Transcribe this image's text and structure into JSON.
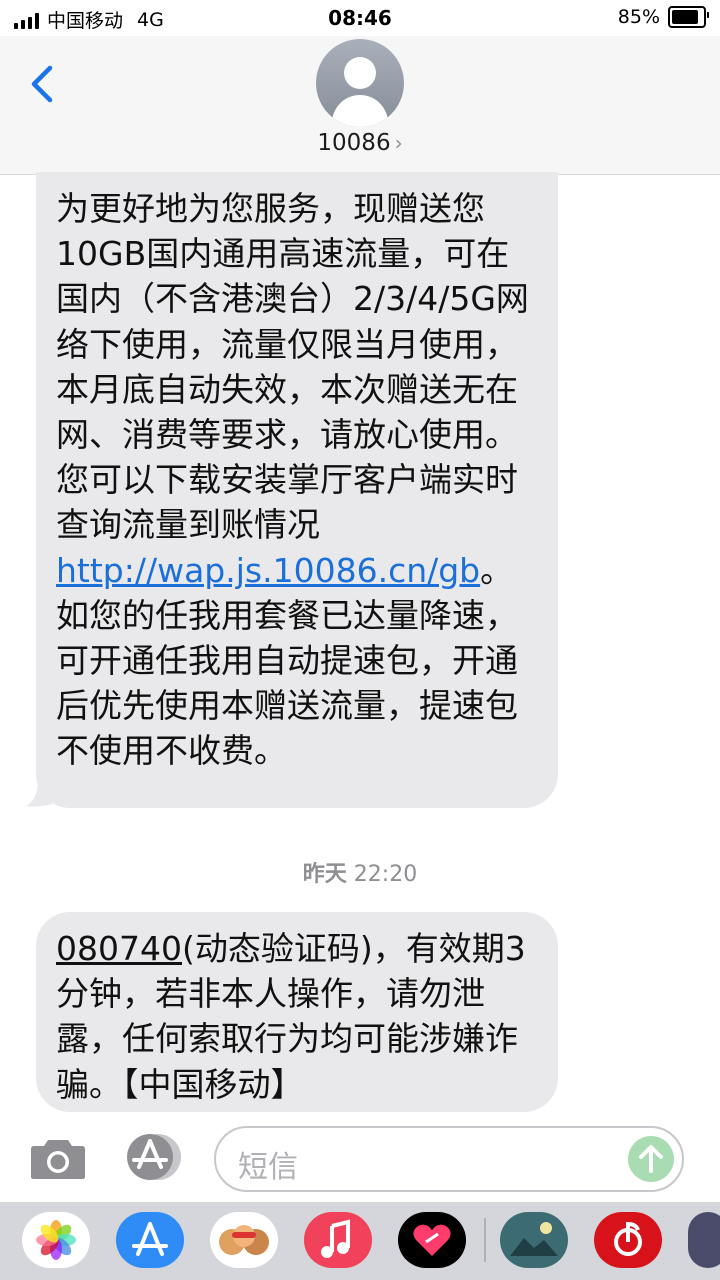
{
  "status_bar": {
    "carrier": "中国移动",
    "network": "4G",
    "time": "08:46",
    "battery_percent": "85%",
    "battery_level": 0.85
  },
  "header": {
    "contact_name": "10086",
    "chevron": "›"
  },
  "messages": [
    {
      "part1": "为更好地为您服务，现赠送您10GB国内通用高速流量，可在国内（不含港澳台）2/3/4/5G网络下使用，流量仅限当月使用，本月底自动失效，本次赠送无在网、消费等要求，请放心使用。您可以下载安装掌厅客户端实时查询流量到账情况",
      "link": "http://wap.js.10086.cn/gb",
      "part2": "。如您的任我用套餐已达量降速，可开通任我用自动提速包，开通后优先使用本赠送流量，提速包不使用不收费。"
    },
    {
      "code": "080740",
      "text": "(动态验证码)，有效期3分钟，若非本人操作，请勿泄露，任何索取行为均可能涉嫌诈骗。【中国移动】"
    }
  ],
  "timestamp": {
    "day": "昨天",
    "time": "22:20"
  },
  "composer": {
    "placeholder": "短信"
  },
  "app_strip": {
    "icons": [
      "photos-icon",
      "app-store-icon",
      "memoji-icon",
      "music-icon",
      "digital-touch-icon",
      "game-app-icon",
      "netease-music-icon",
      "partial-app-icon"
    ]
  },
  "colors": {
    "link": "#1b6fd8",
    "bubble": "#e9e9eb",
    "back_arrow": "#1a73e8",
    "send_button": "#a9dcb2"
  }
}
